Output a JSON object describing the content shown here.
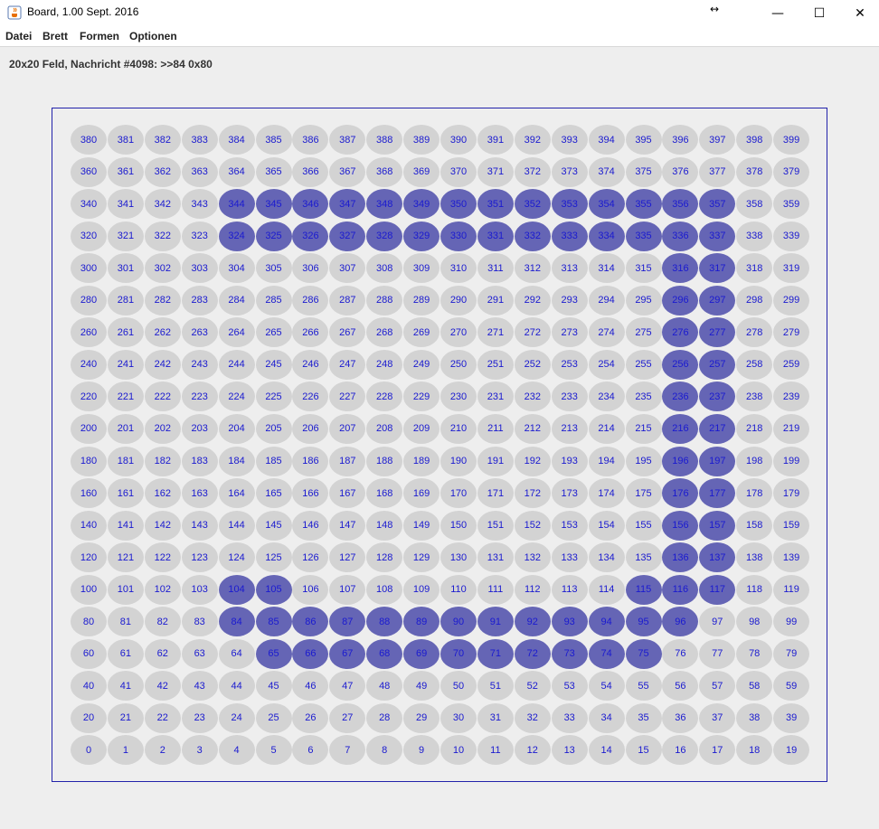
{
  "window": {
    "title": "Board, 1.00 Sept. 2016",
    "icon": "java-cup-icon",
    "controls": {
      "resize_icon": "↔",
      "minimize": "—",
      "maximize": "☐",
      "close": "✕"
    }
  },
  "menu": [
    "Datei",
    "Brett",
    "Formen",
    "Optionen"
  ],
  "status": "20x20 Feld, Nachricht #4098: >>84 0x80",
  "board": {
    "rows": 20,
    "cols": 20,
    "cell_color": "#d3d3d3",
    "active_color": "#6565b5",
    "text_color": "#1a1ad0",
    "active_cells": [
      65,
      66,
      67,
      68,
      69,
      70,
      71,
      72,
      73,
      74,
      75,
      84,
      85,
      86,
      87,
      88,
      89,
      90,
      91,
      92,
      93,
      94,
      95,
      96,
      104,
      105,
      115,
      116,
      117,
      136,
      137,
      156,
      157,
      176,
      177,
      196,
      197,
      216,
      217,
      236,
      237,
      256,
      257,
      276,
      277,
      296,
      297,
      316,
      317,
      324,
      325,
      326,
      327,
      328,
      329,
      330,
      331,
      332,
      333,
      334,
      335,
      336,
      337,
      344,
      345,
      346,
      347,
      348,
      349,
      350,
      351,
      352,
      353,
      354,
      355,
      356,
      357
    ]
  }
}
